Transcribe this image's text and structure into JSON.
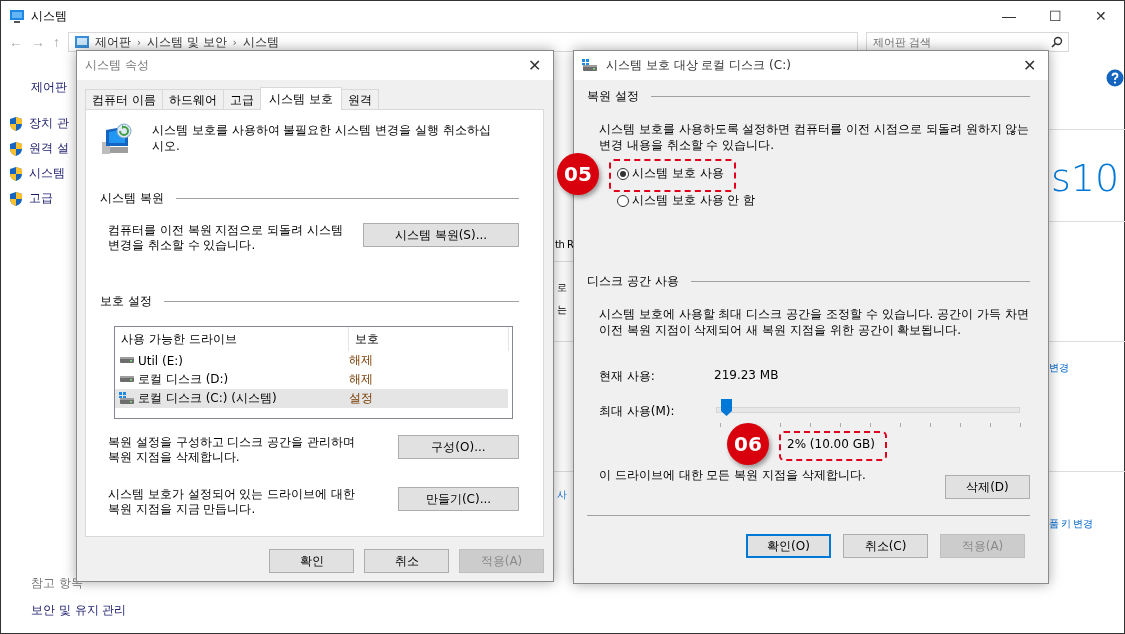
{
  "main_window": {
    "title": "시스템",
    "window_buttons": [
      "—",
      "☐",
      "✕"
    ],
    "nav_buttons": [
      "←",
      "→",
      "↑"
    ],
    "breadcrumb": [
      {
        "label": "제어판"
      },
      {
        "separator": "›",
        "label": "시스템 및 보안"
      },
      {
        "separator": "›",
        "label": "시스템"
      }
    ],
    "search": {
      "placeholder": "제어판 검색"
    },
    "sidebar": {
      "home": "제어판",
      "items": [
        "장치 관",
        "원격 설",
        "시스템",
        "고급"
      ]
    },
    "see_also": {
      "heading": "참고 항목",
      "links": [
        "보안 및 유지 관리"
      ]
    },
    "fragments": [
      {
        "text": "th R",
        "kind": "text"
      },
      {
        "text": "로",
        "kind": "text"
      },
      {
        "text": "는",
        "kind": "text"
      },
      {
        "text": "사",
        "kind": "link"
      },
      {
        "text": "s10",
        "kind": "logo"
      },
      {
        "text": "변경",
        "kind": "link"
      },
      {
        "text": "품 키 변경",
        "kind": "link"
      }
    ]
  },
  "properties_dialog": {
    "title": "시스템 속성",
    "close": "✕",
    "tabs": [
      {
        "label": "컴퓨터 이름",
        "selected": false
      },
      {
        "label": "하드웨어",
        "selected": false
      },
      {
        "label": "고급",
        "selected": false
      },
      {
        "label": "시스템 보호",
        "selected": true
      },
      {
        "label": "원격",
        "selected": false
      }
    ],
    "intro": "시스템 보호를 사용하여 불필요한 시스템 변경을 실행 취소하십시오.",
    "restore_section": {
      "heading": "시스템 복원",
      "text": "컴퓨터를 이전 복원 지점으로 되돌려 시스템 변경을 취소할 수 있습니다.",
      "button": "시스템 복원(S)..."
    },
    "protection_section": {
      "heading": "보호 설정",
      "columns": [
        "사용 가능한 드라이브",
        "보호"
      ],
      "rows": [
        {
          "drive": "Util (E:)",
          "protection": "해제",
          "kind": "disk",
          "selected": false
        },
        {
          "drive": "로컬 디스크 (D:)",
          "protection": "해제",
          "kind": "disk",
          "selected": false
        },
        {
          "drive": "로컬 디스크 (C:) (시스템)",
          "protection": "설정",
          "kind": "system",
          "selected": true
        }
      ],
      "configure_text": "복원 설정을 구성하고 디스크 공간을 관리하며 복원 지점을 삭제합니다.",
      "configure_button": "구성(O)...",
      "create_text": "시스템 보호가 설정되어 있는 드라이브에 대한 복원 지점을 지금 만듭니다.",
      "create_button": "만들기(C)..."
    },
    "buttons": [
      {
        "label": "확인",
        "disabled": false
      },
      {
        "label": "취소",
        "disabled": false
      },
      {
        "label": "적용(A)",
        "disabled": true
      }
    ]
  },
  "disk_dialog": {
    "title": "시스템 보호 대상 로컬 디스크 (C:)",
    "close": "✕",
    "restore_settings": {
      "heading": "복원 설정",
      "text": "시스템 보호를 사용하도록 설정하면 컴퓨터를 이전 시점으로 되돌려 원하지 않는 변경 내용을 취소할 수 있습니다.",
      "options": [
        {
          "label": "시스템 보호 사용",
          "selected": true
        },
        {
          "label": "시스템 보호 사용 안 함",
          "selected": false
        }
      ]
    },
    "disk_usage": {
      "heading": "디스크 공간 사용",
      "text": "시스템 보호에 사용할 최대 디스크 공간을 조정할 수 있습니다. 공간이 가득 차면 이전 복원 지점이 삭제되어 새 복원 지점을 위한 공간이 확보됩니다.",
      "current_label": "현재 사용:",
      "current_value": "219.23 MB",
      "max_label": "최대 사용(M):",
      "max_slider": {
        "level": 0.02
      },
      "max_value": "2% (10.00 GB)",
      "delete_text": "이 드라이브에 대한 모든 복원 지점을 삭제합니다.",
      "delete_button": "삭제(D)"
    },
    "buttons": [
      {
        "label": "확인(O)",
        "disabled": false,
        "focused": true
      },
      {
        "label": "취소(C)",
        "disabled": false,
        "focused": false
      },
      {
        "label": "적용(A)",
        "disabled": true,
        "focused": false
      }
    ]
  },
  "annotations": [
    {
      "label": "05"
    },
    {
      "label": "06"
    }
  ]
}
